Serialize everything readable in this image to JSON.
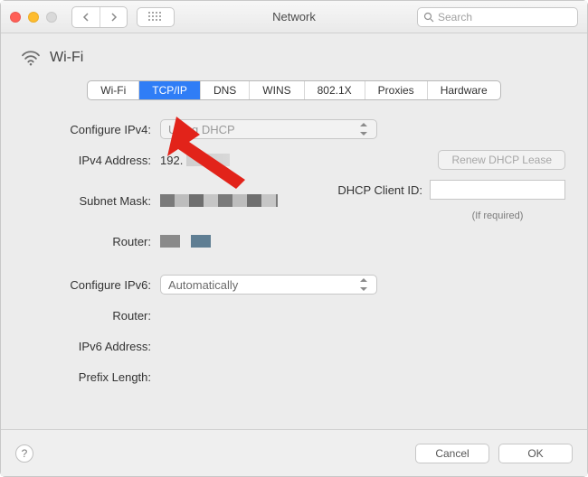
{
  "window": {
    "title": "Network",
    "search_placeholder": "Search"
  },
  "section": {
    "title": "Wi-Fi"
  },
  "tabs": {
    "wifi": "Wi-Fi",
    "tcpip": "TCP/IP",
    "dns": "DNS",
    "wins": "WINS",
    "dot1x": "802.1X",
    "proxies": "Proxies",
    "hardware": "Hardware",
    "selected": "tcpip"
  },
  "form": {
    "configure_ipv4_label": "Configure IPv4:",
    "configure_ipv4_value": "Using DHCP",
    "ipv4_address_label": "IPv4 Address:",
    "ipv4_address_value": "192.",
    "subnet_mask_label": "Subnet Mask:",
    "router_label": "Router:",
    "renew_button": "Renew DHCP Lease",
    "dhcp_client_id_label": "DHCP Client ID:",
    "dhcp_client_id_value": "",
    "dhcp_client_hint": "(If required)",
    "configure_ipv6_label": "Configure IPv6:",
    "configure_ipv6_value": "Automatically",
    "router6_label": "Router:",
    "ipv6_address_label": "IPv6 Address:",
    "prefix_length_label": "Prefix Length:"
  },
  "footer": {
    "help": "?",
    "cancel": "Cancel",
    "ok": "OK"
  }
}
